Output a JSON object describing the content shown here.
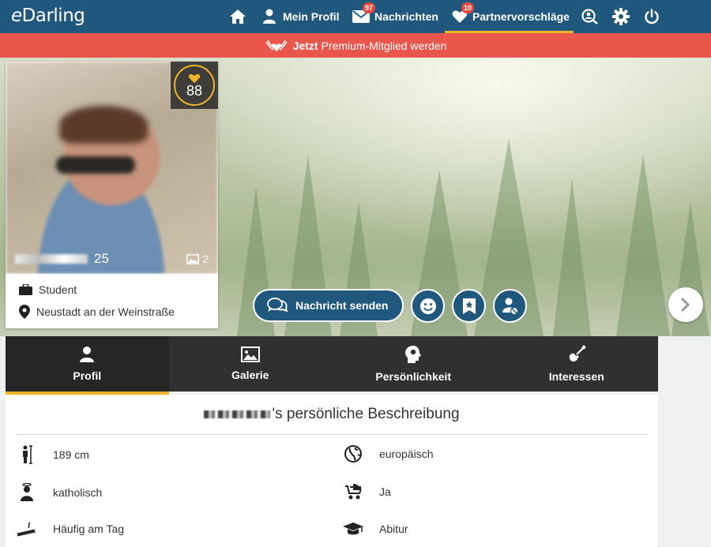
{
  "header": {
    "logo": "eDarling",
    "nav": {
      "home_label": "",
      "profile_label": "Mein Profil",
      "messages_label": "Nachrichten",
      "messages_badge": "97",
      "matches_label": "Partnervorschläge",
      "matches_badge": "10"
    },
    "active_tab": "matches",
    "accent_color": "#f0b429",
    "bar_color": "#20577c"
  },
  "promo": {
    "strong": "Jetzt",
    "text": "Premium-Mitglied werden",
    "color": "#e9564c"
  },
  "profile": {
    "match_score": "88",
    "age": "25",
    "photo_count": "2",
    "occupation": "Student",
    "location": "Neustadt an der Weinstraße"
  },
  "actions": {
    "send_message": "Nachricht senden"
  },
  "tabs": [
    {
      "label": "Profil",
      "icon": "person-icon"
    },
    {
      "label": "Galerie",
      "icon": "image-icon"
    },
    {
      "label": "Persönlichkeit",
      "icon": "head-icon"
    },
    {
      "label": "Interessen",
      "icon": "guitar-icon"
    }
  ],
  "active_content_tab": "Profil",
  "description_title_suffix": "'s persönliche Beschreibung",
  "attributes": [
    {
      "icon": "height-icon",
      "value": "189 cm"
    },
    {
      "icon": "globe-icon",
      "value": "europäisch"
    },
    {
      "icon": "religion-icon",
      "value": "katholisch"
    },
    {
      "icon": "stroller-icon",
      "value": "Ja"
    },
    {
      "icon": "cigarette-icon",
      "value": "Häufig am Tag"
    },
    {
      "icon": "graduation-cap-icon",
      "value": "Abitur"
    }
  ]
}
